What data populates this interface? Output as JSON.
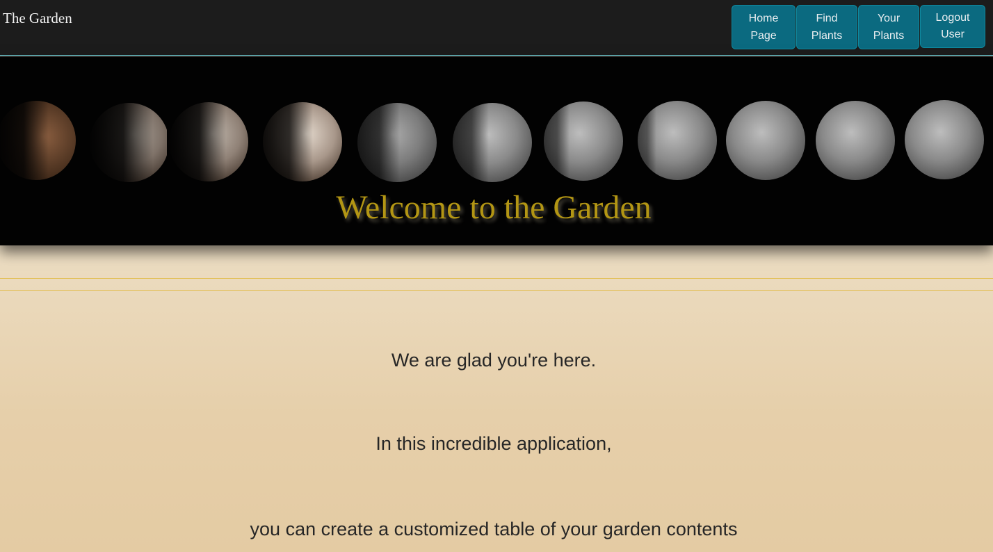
{
  "header": {
    "brand": "The Garden",
    "nav": [
      {
        "label": "Home\nPage"
      },
      {
        "label": "Find\nPlants"
      },
      {
        "label": "Your\nPlants"
      },
      {
        "label": "Logout\nUser"
      }
    ]
  },
  "hero": {
    "title": "Welcome to the Garden",
    "image": "moon-phases-banner"
  },
  "main": {
    "lines": [
      "We are glad you're here.",
      "In this incredible application,",
      "you can create a customized table of your garden contents"
    ]
  },
  "colors": {
    "topbar": "#1c1c1c",
    "nav_button": "#0b6a80",
    "hero_background": "#020202",
    "hero_title": "#b39614",
    "rule": "#e2bf55",
    "page_background": "#f4e8d8"
  }
}
